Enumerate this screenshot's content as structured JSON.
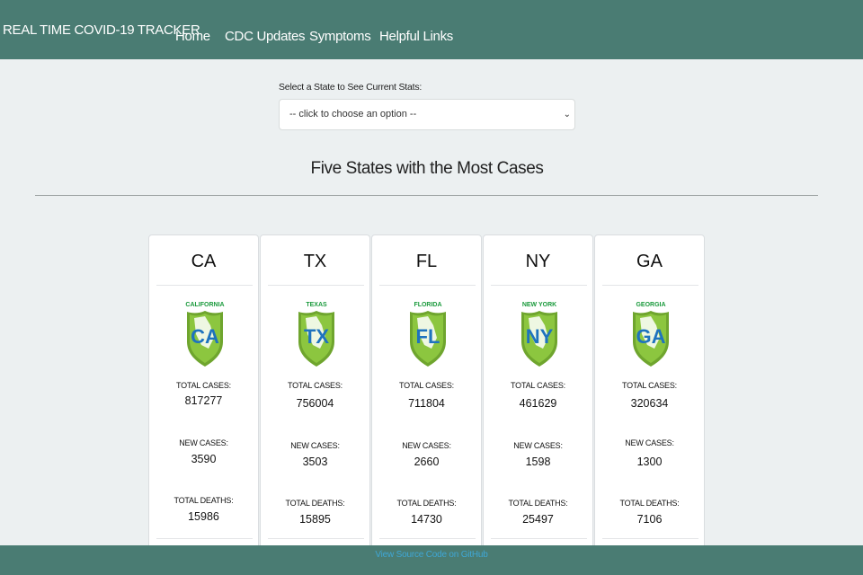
{
  "navbar": {
    "brand": "REAL TIME COVID-19 TRACKER",
    "links": [
      "Home",
      "CDC Updates",
      "Symptoms",
      "Helpful Links"
    ]
  },
  "selector": {
    "label": "Select a State to See Current Stats:",
    "selected": "-- click to choose an option --"
  },
  "section": {
    "title": "Five States with the Most Cases"
  },
  "labels": {
    "total_cases": "TOTAL CASES:",
    "new_cases": "NEW CASES:",
    "total_deaths": "TOTAL DEATHS:"
  },
  "states": [
    {
      "abbr": "CA",
      "name": "CALIFORNIA",
      "total_cases": "817277",
      "new_cases": "3590",
      "total_deaths": "15986"
    },
    {
      "abbr": "TX",
      "name": "TEXAS",
      "total_cases": "756004",
      "new_cases": "3503",
      "total_deaths": "15895"
    },
    {
      "abbr": "FL",
      "name": "FLORIDA",
      "total_cases": "711804",
      "new_cases": "2660",
      "total_deaths": "14730"
    },
    {
      "abbr": "NY",
      "name": "NEW YORK",
      "total_cases": "461629",
      "new_cases": "1598",
      "total_deaths": "25497"
    },
    {
      "abbr": "GA",
      "name": "GEORGIA",
      "total_cases": "320634",
      "new_cases": "1300",
      "total_deaths": "7106"
    }
  ],
  "footer": {
    "link": "View Source Code on GitHub"
  },
  "colors": {
    "nav": "#4a7c73",
    "background": "#ecf0f1",
    "badge_green": "#8cc63f",
    "badge_label": "#1a9a3c",
    "badge_letters": "#1e73be",
    "footer_link": "#3fa7d6"
  }
}
